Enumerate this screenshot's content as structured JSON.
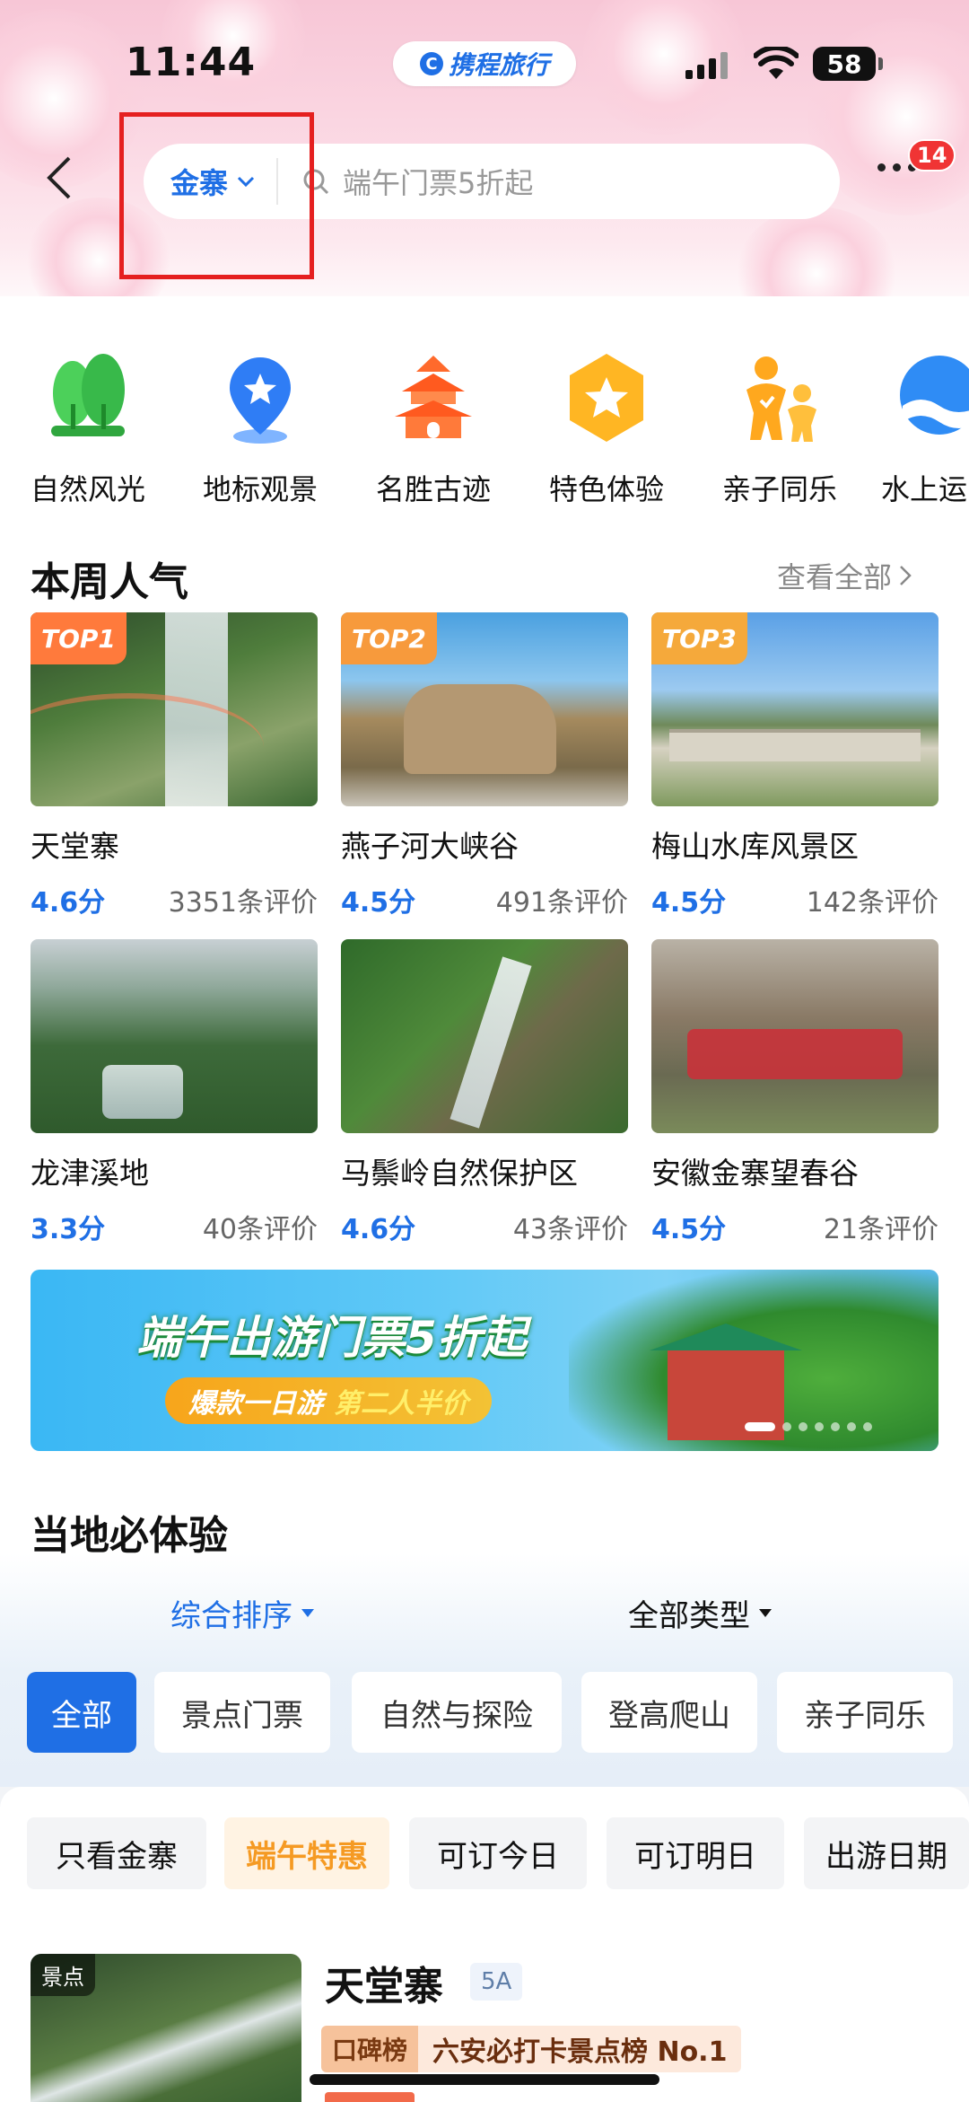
{
  "status_bar": {
    "time": "11:44",
    "app_badge": "携程旅行",
    "battery": "58"
  },
  "header": {
    "city": "金寨",
    "search_placeholder": "端午门票5折起",
    "notification_count": "14"
  },
  "categories": [
    {
      "label": "自然风光",
      "icon": "trees-icon"
    },
    {
      "label": "地标观景",
      "icon": "landmark-pin-icon"
    },
    {
      "label": "名胜古迹",
      "icon": "pagoda-icon"
    },
    {
      "label": "特色体验",
      "icon": "star-badge-icon"
    },
    {
      "label": "亲子同乐",
      "icon": "parent-child-icon"
    },
    {
      "label": "水上运",
      "icon": "water-icon"
    }
  ],
  "weekly_popular": {
    "title": "本周人气",
    "see_all": "查看全部",
    "items": [
      {
        "rank": "TOP1",
        "name": "天堂寨",
        "score": "4.6分",
        "reviews": "3351条评价"
      },
      {
        "rank": "TOP2",
        "name": "燕子河大峡谷",
        "score": "4.5分",
        "reviews": "491条评价"
      },
      {
        "rank": "TOP3",
        "name": "梅山水库风景区",
        "score": "4.5分",
        "reviews": "142条评价"
      },
      {
        "rank": "",
        "name": "龙津溪地",
        "score": "3.3分",
        "reviews": "40条评价"
      },
      {
        "rank": "",
        "name": "马鬃岭自然保护区",
        "score": "4.6分",
        "reviews": "43条评价"
      },
      {
        "rank": "",
        "name": "安徽金寨望春谷",
        "score": "4.5分",
        "reviews": "21条评价"
      }
    ]
  },
  "banner": {
    "headline": "端午出游门票5折起",
    "sub_left": "爆款一日游",
    "sub_right": "第二人半价"
  },
  "local_experience": {
    "title": "当地必体验",
    "sort_label": "综合排序",
    "type_label": "全部类型",
    "chips": [
      "全部",
      "景点门票",
      "自然与探险",
      "登高爬山",
      "亲子同乐"
    ],
    "filters": [
      "只看金寨",
      "端午特惠",
      "可订今日",
      "可订明日",
      "出游日期"
    ]
  },
  "listing": {
    "tag": "景点",
    "name": "天堂寨",
    "level": "5A",
    "rank_label": "口碑榜",
    "rank_text": "六安必打卡景点榜 No.1"
  },
  "colors": {
    "accent": "#1f6fe5",
    "highlight_box": "#e52020",
    "hot_orange": "#f59a23"
  }
}
